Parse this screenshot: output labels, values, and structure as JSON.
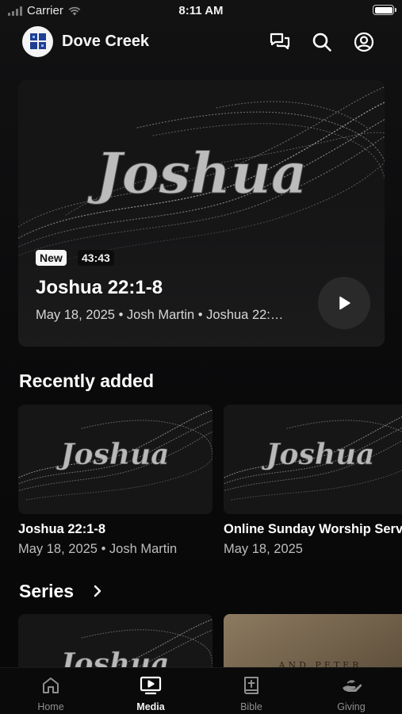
{
  "status_bar": {
    "carrier": "Carrier",
    "time": "8:11 AM"
  },
  "header": {
    "church_name": "Dove Creek",
    "icons": [
      "chat-icon",
      "search-icon",
      "account-icon"
    ]
  },
  "hero": {
    "artwork_text": "Joshua",
    "badge": "New",
    "duration": "43:43",
    "title": "Joshua 22:1-8",
    "meta": "May 18, 2025 • Josh Martin • Joshua 22:…"
  },
  "recently_added": {
    "heading": "Recently added",
    "items": [
      {
        "artwork_text": "Joshua",
        "title": "Joshua 22:1-8",
        "meta": "May 18, 2025 • Josh Martin"
      },
      {
        "artwork_text": "Joshua",
        "title": "Online Sunday Worship Service",
        "meta": "May 18, 2025"
      }
    ]
  },
  "series": {
    "heading": "Series",
    "items": [
      {
        "artwork_text": "Joshua"
      },
      {
        "artwork_text": "AND PETER"
      }
    ]
  },
  "tab_bar": {
    "active": "Media",
    "tabs": [
      {
        "label": "Home",
        "icon": "home-icon"
      },
      {
        "label": "Media",
        "icon": "media-icon"
      },
      {
        "label": "Bible",
        "icon": "bible-icon"
      },
      {
        "label": "Giving",
        "icon": "giving-icon"
      }
    ]
  },
  "colors": {
    "background": "#0d0d0e",
    "card": "#1b1b1c",
    "accent": "#ffffff",
    "muted": "#8f8f8f"
  }
}
